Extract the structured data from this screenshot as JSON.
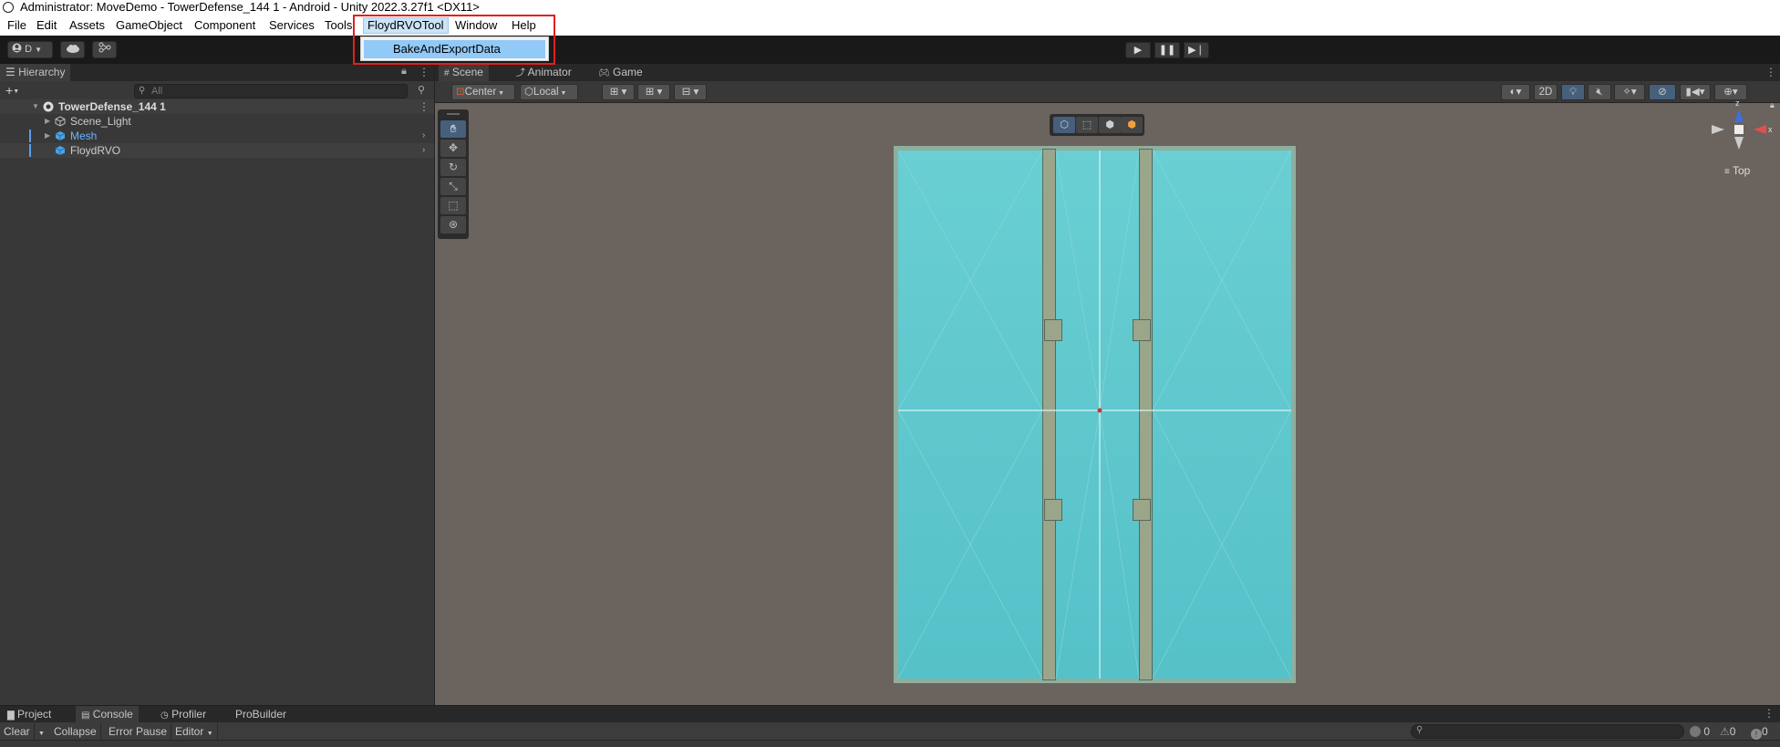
{
  "window": {
    "title": "Administrator: MoveDemo - TowerDefense_144 1 - Android - Unity 2022.3.27f1 <DX11>"
  },
  "menubar": {
    "items": [
      "File",
      "Edit",
      "Assets",
      "GameObject",
      "Component",
      "Services",
      "Tools",
      "FloydRVOTool",
      "Window",
      "Help"
    ],
    "active": "FloydRVOTool",
    "dropdown_items": [
      "BakeAndExportData"
    ]
  },
  "toolbar": {
    "account_label": "D",
    "play_icons": [
      "play-icon",
      "pause-icon",
      "step-icon"
    ]
  },
  "hierarchy": {
    "tab_label": "Hierarchy",
    "search_placeholder": "All",
    "scene_name": "TowerDefense_144 1",
    "items": [
      {
        "label": "Scene_Light",
        "has_children": true,
        "prefab": false
      },
      {
        "label": "Mesh",
        "has_children": true,
        "prefab": true
      },
      {
        "label": "FloydRVO",
        "has_children": false,
        "prefab": false
      }
    ]
  },
  "scene": {
    "tabs": [
      "Scene",
      "Animator",
      "Game"
    ],
    "active_tab": "Scene",
    "pivot_mode": "Center",
    "pivot_rotation": "Local",
    "mode_2d_label": "2D",
    "view_label": "Top",
    "gizmo_axes": {
      "y": "z",
      "x": "x"
    },
    "colors": {
      "water": "#5cc6cc",
      "wall": "#9aa58a",
      "background": "#6b635d"
    }
  },
  "bottom": {
    "tabs": [
      "Project",
      "Console",
      "Profiler",
      "ProBuilder"
    ],
    "active_tab": "Console",
    "console": {
      "clear_label": "Clear",
      "collapse_label": "Collapse",
      "error_pause_label": "Error Pause",
      "editor_label": "Editor",
      "log_count": "0",
      "warn_count": "0",
      "error_count": "0"
    }
  }
}
